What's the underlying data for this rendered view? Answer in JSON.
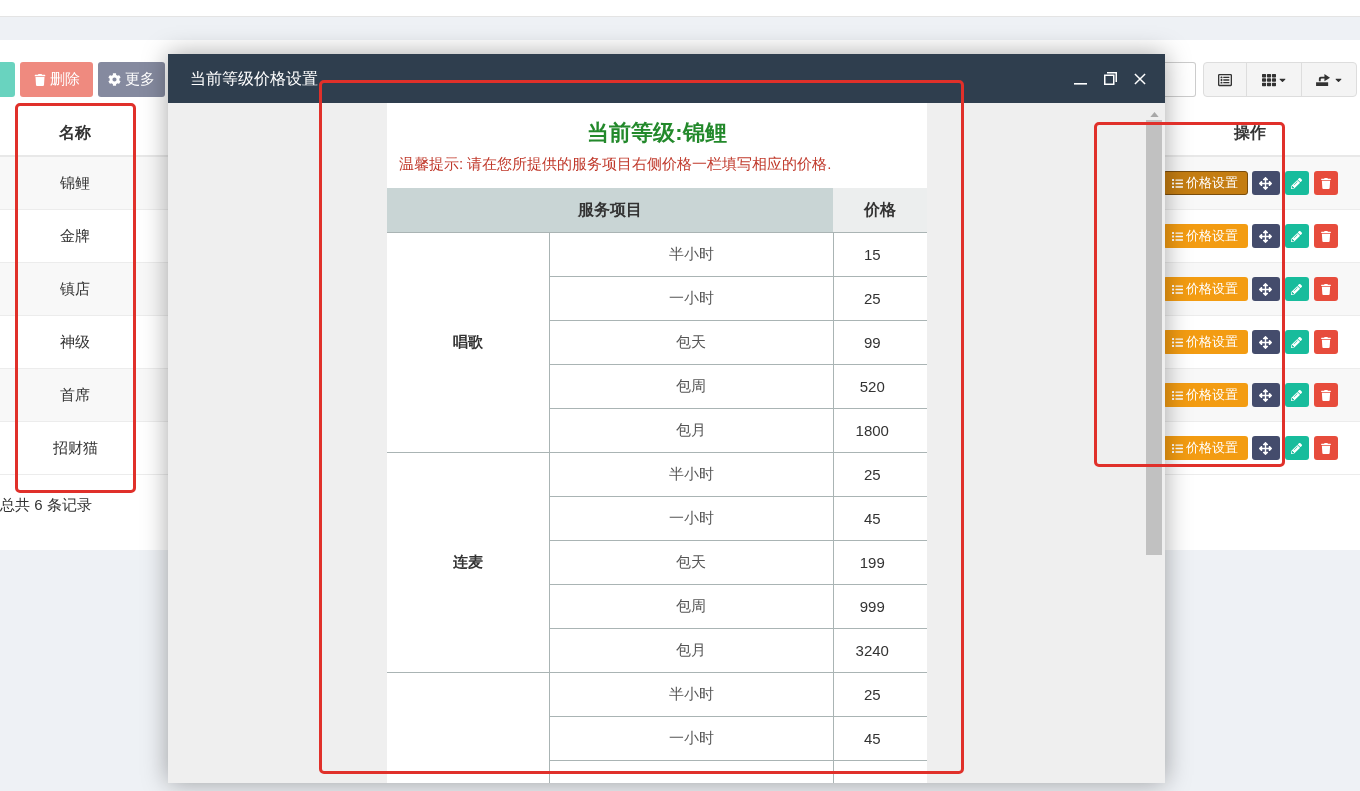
{
  "toolbar": {
    "buttons": [
      {
        "kind": "stub",
        "disabled": true
      },
      {
        "kind": "delete",
        "label": "删除",
        "disabled": true
      },
      {
        "kind": "more",
        "label": "更多",
        "disabled": true
      }
    ]
  },
  "table": {
    "columns": [
      "名称",
      "操作"
    ],
    "rows": [
      {
        "name": "锦鲤",
        "action": "价格设置",
        "hovered": true
      },
      {
        "name": "金牌",
        "action": "价格设置",
        "hovered": false
      },
      {
        "name": "镇店",
        "action": "价格设置",
        "hovered": false
      },
      {
        "name": "神级",
        "action": "价格设置",
        "hovered": false
      },
      {
        "name": "首席",
        "action": "价格设置",
        "hovered": false
      },
      {
        "name": "招财猫",
        "action": "价格设置",
        "hovered": false
      }
    ]
  },
  "footer": "总共 6 条记录",
  "modal": {
    "title": "当前等级价格设置",
    "heading": "当前等级:锦鲤",
    "hint": "温馨提示: 请在您所提供的服务项目右侧价格一栏填写相应的价格.",
    "columns": [
      "服务项目",
      "价格"
    ],
    "groups": [
      {
        "name": "唱歌",
        "items": [
          {
            "service": "半小时",
            "price": "15"
          },
          {
            "service": "一小时",
            "price": "25"
          },
          {
            "service": "包天",
            "price": "99"
          },
          {
            "service": "包周",
            "price": "520"
          },
          {
            "service": "包月",
            "price": "1800"
          }
        ]
      },
      {
        "name": "连麦",
        "items": [
          {
            "service": "半小时",
            "price": "25"
          },
          {
            "service": "一小时",
            "price": "45"
          },
          {
            "service": "包天",
            "price": "199"
          },
          {
            "service": "包周",
            "price": "999"
          },
          {
            "service": "包月",
            "price": "3240"
          }
        ]
      },
      {
        "items": [
          {
            "service": "半小时",
            "price": "25"
          },
          {
            "service": "一小时",
            "price": "45"
          }
        ]
      }
    ]
  }
}
